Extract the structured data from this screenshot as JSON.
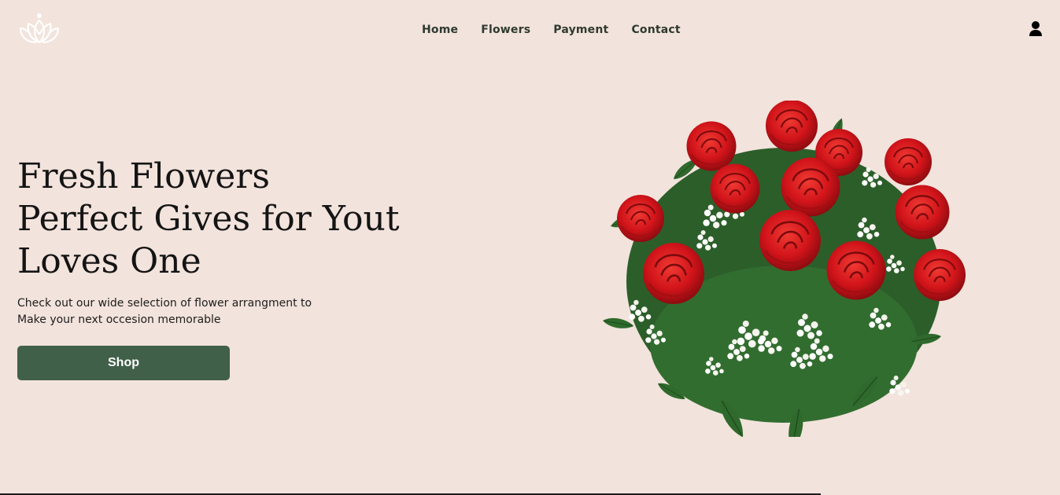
{
  "header": {
    "logo_icon": "lotus-logo-icon",
    "nav": [
      {
        "label": "Home"
      },
      {
        "label": "Flowers"
      },
      {
        "label": "Payment"
      },
      {
        "label": "Contact"
      }
    ],
    "user_icon": "user-icon"
  },
  "hero": {
    "title_lines": [
      "Fresh Flowers",
      "Perfect Gives for Yout",
      "Loves One"
    ],
    "subtitle_lines": [
      "Check out our wide selection of flower arrangment to",
      "Make your next occesion memorable"
    ],
    "cta_label": "Shop",
    "image": "red-roses-bouquet"
  },
  "colors": {
    "background": "#f2e3dc",
    "accent": "#40604a",
    "rose": "#d9141a",
    "leaf": "#2f6a2c"
  }
}
